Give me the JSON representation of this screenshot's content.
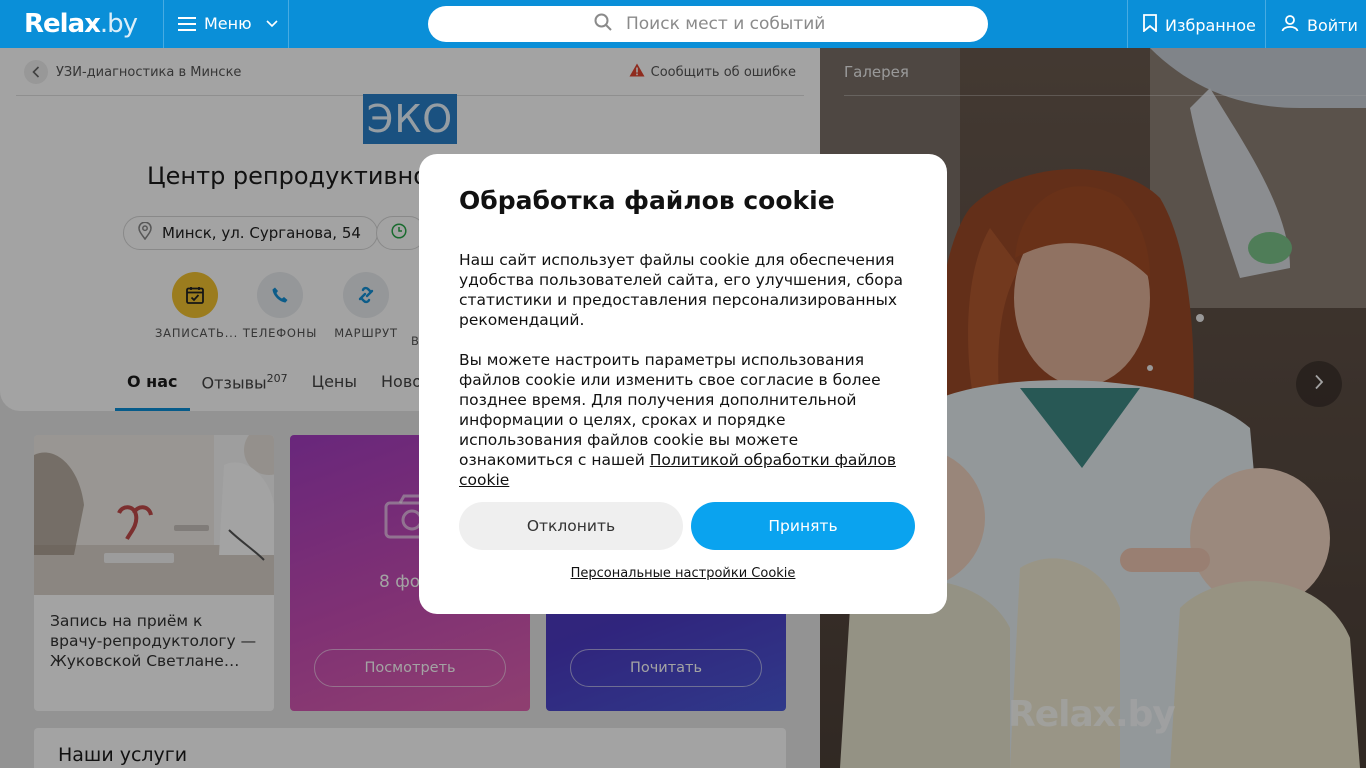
{
  "header": {
    "logo": "Relax",
    "logo_suffix": ".by",
    "menu_label": "Меню",
    "search_placeholder": "Поиск мест и событий",
    "favorites_label": "Избранное",
    "login_label": "Войти",
    "brand_color": "#0a8fd8"
  },
  "page": {
    "breadcrumb": "УЗИ-диагностика в Минске",
    "report_error": "Сообщить об ошибке",
    "logo_text": "ЭКО",
    "title": "Центр репродуктивно",
    "address": "Минск, ул. Сурганова, 54",
    "actions": [
      {
        "label": "ЗАПИСАТЬ...",
        "icon": "calendar-check-icon"
      },
      {
        "label": "ТЕЛЕФОНЫ",
        "icon": "phone-icon"
      },
      {
        "label": "МАРШРУТ",
        "icon": "route-icon"
      },
      {
        "label": "В",
        "icon": "more-icon"
      }
    ],
    "tabs": [
      {
        "label": "О нас",
        "badge": ""
      },
      {
        "label": "Отзывы",
        "badge": "207"
      },
      {
        "label": "Цены",
        "badge": ""
      },
      {
        "label": "Ново",
        "badge": ""
      }
    ],
    "tiles": {
      "article_text": "Запись на приём к врачу-репродуктологу — Жуковской Светлане…",
      "photos_count": "8 фо",
      "view_button": "Посмотреть",
      "read_button": "Почитать"
    },
    "services_heading": "Наши услуги"
  },
  "gallery": {
    "label": "Галерея",
    "watermark": "Relax.by"
  },
  "cookie_modal": {
    "title": "Обработка файлов cookie",
    "paragraph1": "Наш сайт использует файлы cookie для обеспечения удобства пользователей сайта, его улучшения, сбора статистики и предоставления персонализированных рекомендаций.",
    "paragraph2": "Вы можете настроить параметры использования файлов cookie или изменить свое согласие в более позднее время. Для получения дополнительной информации о целях, сроках и порядке использования файлов cookie вы можете ознакомиться с нашей",
    "policy_link": "Политикой обработки файлов cookie",
    "decline_label": "Отклонить",
    "accept_label": "Принять",
    "settings_link": "Персональные настройки Cookie",
    "accept_color": "#0aa3ef"
  }
}
